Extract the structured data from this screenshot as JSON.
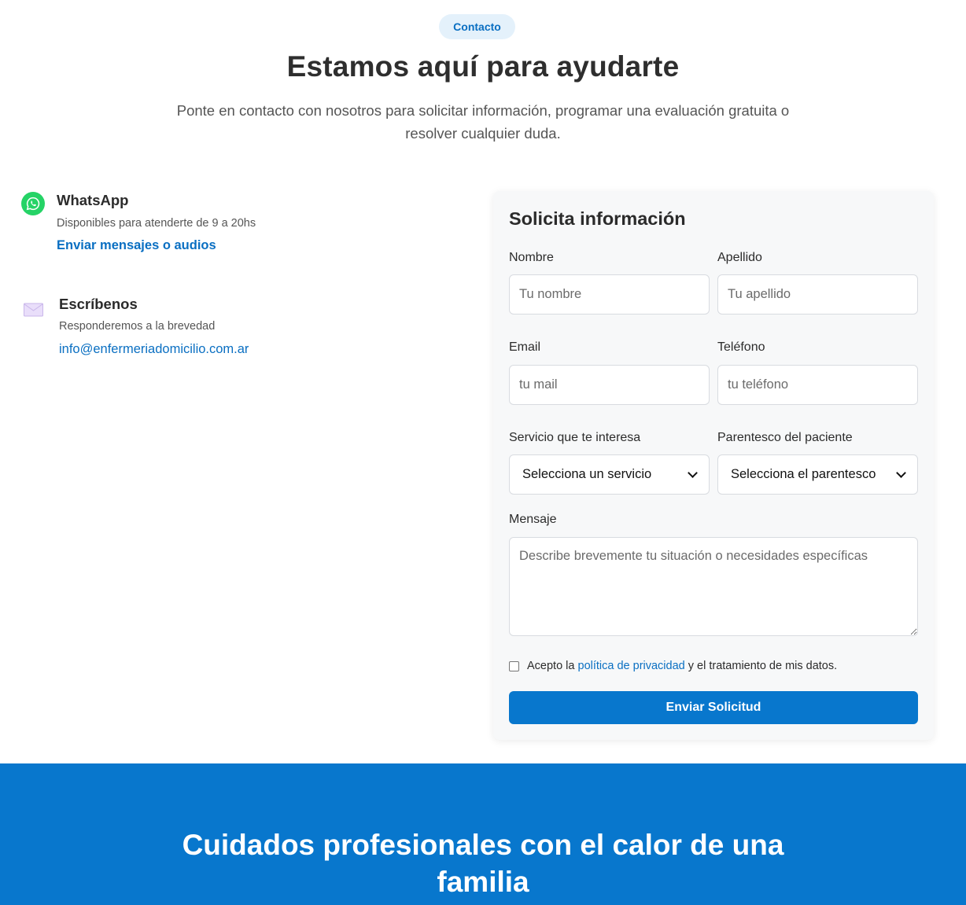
{
  "header": {
    "badge": "Contacto",
    "title": "Estamos aquí para ayudarte",
    "subtitle": "Ponte en contacto con nosotros para solicitar información, programar una evaluación gratuita o resolver cualquier duda."
  },
  "contacts": {
    "whatsapp": {
      "icon": "whatsapp-icon",
      "title": "WhatsApp",
      "desc": "Disponibles para atenderte de 9 a 20hs",
      "link": "Enviar mensajes o audios"
    },
    "email": {
      "icon": "envelope-icon",
      "title": "Escríbenos",
      "desc": "Responderemos a la brevedad",
      "link": "info@enfermeriadomicilio.com.ar"
    }
  },
  "form": {
    "title": "Solicita información",
    "nombre": {
      "label": "Nombre",
      "placeholder": "Tu nombre"
    },
    "apellido": {
      "label": "Apellido",
      "placeholder": "Tu apellido"
    },
    "email": {
      "label": "Email",
      "placeholder": "tu mail"
    },
    "telefono": {
      "label": "Teléfono",
      "placeholder": "tu teléfono"
    },
    "servicio": {
      "label": "Servicio que te interesa",
      "selected": "Selecciona un servicio"
    },
    "parentesco": {
      "label": "Parentesco del paciente",
      "selected": "Selecciona el parentesco"
    },
    "mensaje": {
      "label": "Mensaje",
      "placeholder": "Describe brevemente tu situación o necesidades específicas"
    },
    "consent": {
      "prefix": "Acepto la ",
      "link": "política de privacidad",
      "suffix": " y el tratamiento de mis datos."
    },
    "submit": "Enviar Solicitud"
  },
  "band": {
    "title": "Cuidados profesionales con el calor de una familia"
  },
  "colors": {
    "accent": "#0877cd",
    "whatsapp": "#25d366",
    "badge_bg": "#e4f1fb"
  }
}
